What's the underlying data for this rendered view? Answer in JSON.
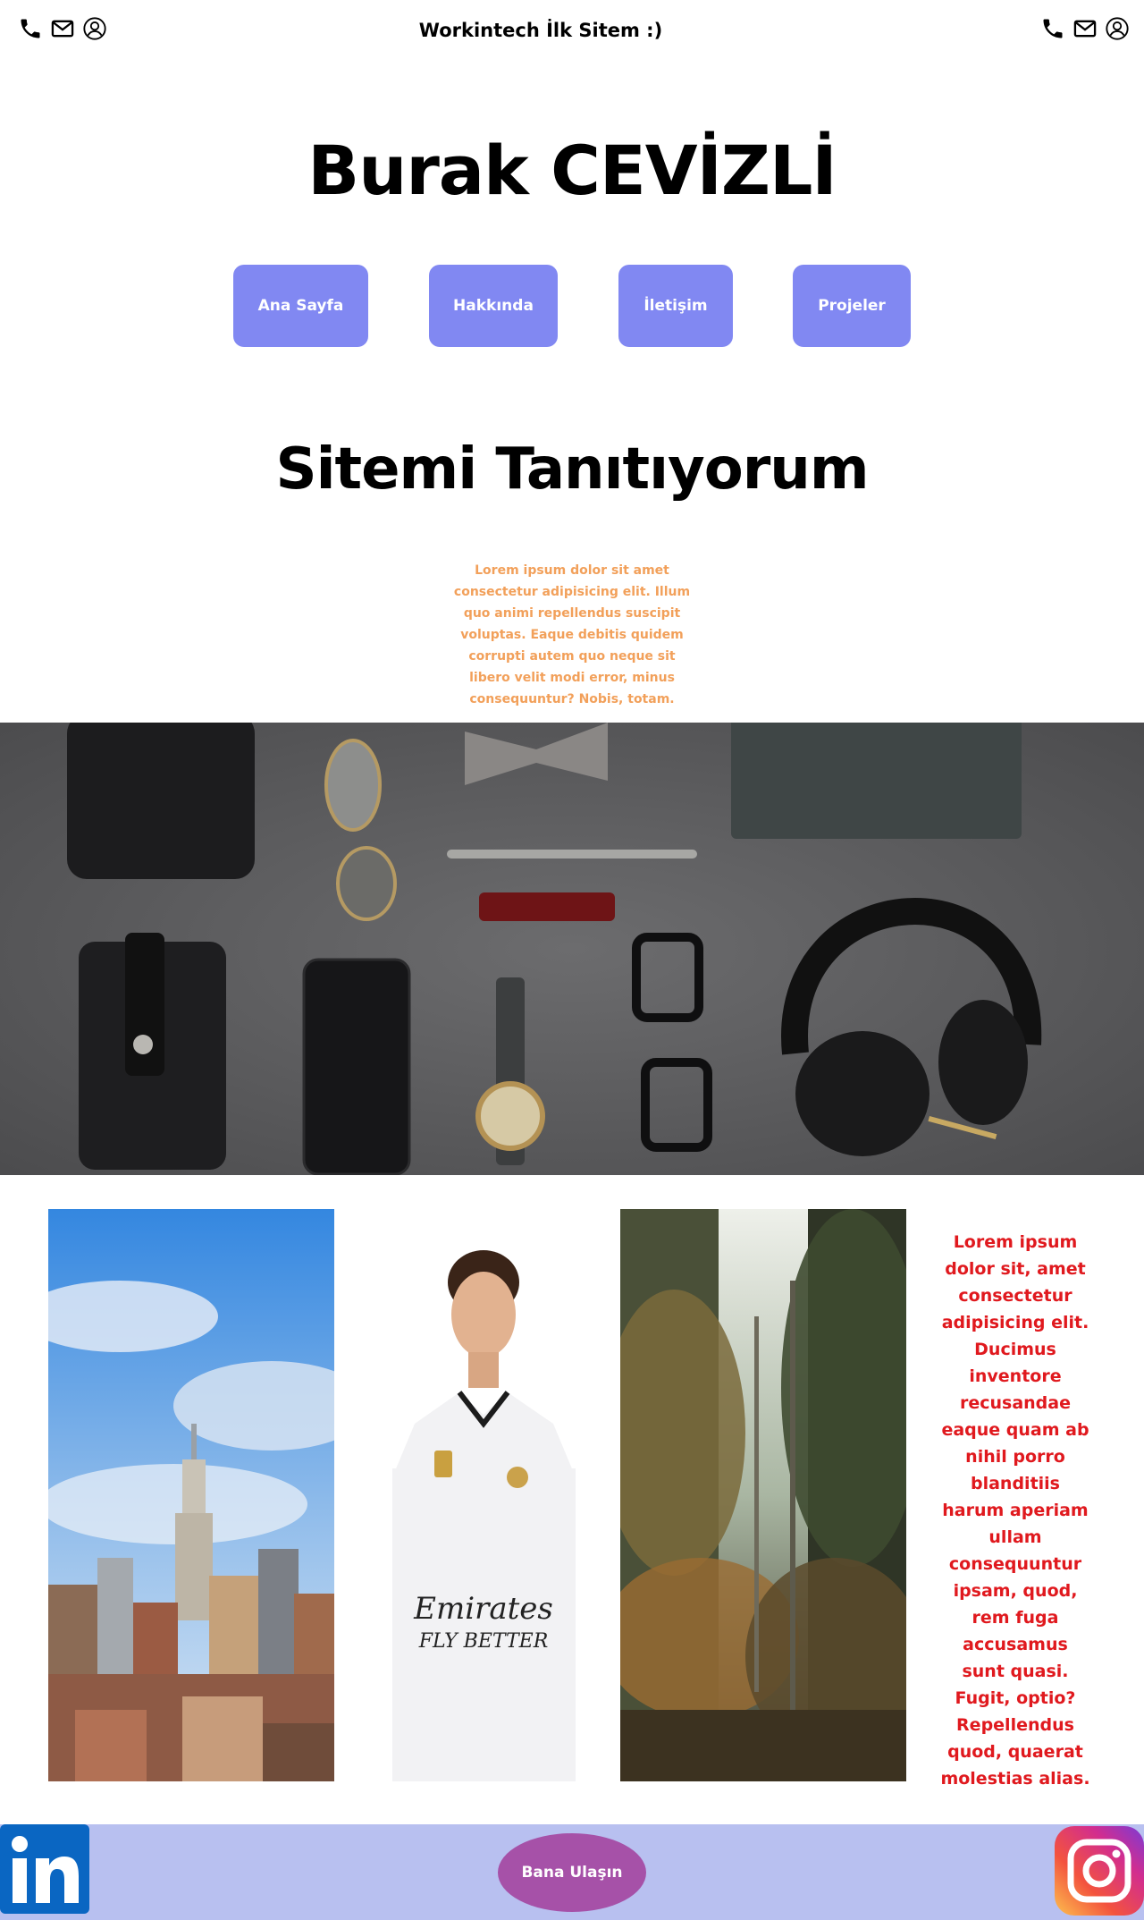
{
  "header": {
    "title": "Workintech İlk Sitem :)",
    "icons": [
      "phone-icon",
      "mail-icon",
      "user-icon"
    ]
  },
  "hero": {
    "name": "Burak CEVİZLİ",
    "nav": [
      "Ana Sayfa",
      "Hakkında",
      "İletişim",
      "Projeler"
    ],
    "nav_color": "#8188f2",
    "subtitle": "Sitemi Tanıtıyorum",
    "intro": "Lorem ipsum dolor sit amet consectetur adipisicing elit. Illum quo animi repellendus suscipit voluptas. Eaque debitis quidem corrupti autem quo neque sit libero velit modi error, minus consequuntur? Nobis, totam.",
    "intro_color": "#f2a05a"
  },
  "gallery": {
    "images": [
      "city-skyline-image",
      "football-player-image",
      "forest-image"
    ],
    "side_text": "Lorem ipsum dolor sit, amet consectetur adipisicing elit. Ducimus inventore recusandae eaque quam ab nihil porro blanditiis harum aperiam ullam consequuntur ipsam, quod, rem fuga accusamus sunt quasi. Fugit, optio? Repellendus quod, quaerat molestias alias.",
    "side_text_color": "#e0191e"
  },
  "footer": {
    "contact_label": "Bana Ulaşın",
    "background": "#b8c0f0",
    "button_color": "#a651a8",
    "icons": [
      "linkedin-icon",
      "instagram-icon"
    ]
  }
}
